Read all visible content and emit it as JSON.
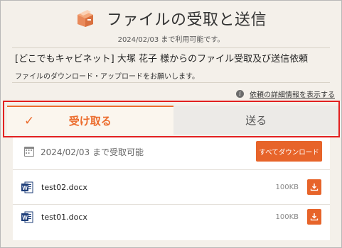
{
  "header": {
    "title": "ファイルの受取と送信",
    "availability": "2024/02/03 まで利用可能です。"
  },
  "request": {
    "title": "[どこでもキャビネット] 大塚 花子 様からのファイル受取及び送信依頼",
    "description": "ファイルのダウンロード・アップロードをお願いします。",
    "detail_link": "依頼の詳細情報を表示する"
  },
  "tabs": [
    {
      "label": "受け取る",
      "active": true
    },
    {
      "label": "送る",
      "active": false
    }
  ],
  "receive": {
    "available_until": "2024/02/03 まで受取可能",
    "download_all_label": "すべてダウンロード",
    "files": [
      {
        "name": "test02.docx",
        "size": "100KB",
        "icon": "word-doc-icon"
      },
      {
        "name": "test01.docx",
        "size": "100KB",
        "icon": "word-doc-icon"
      }
    ]
  },
  "colors": {
    "accent": "#e7642a",
    "highlight": "#e22020",
    "background": "#f4f0ea"
  }
}
